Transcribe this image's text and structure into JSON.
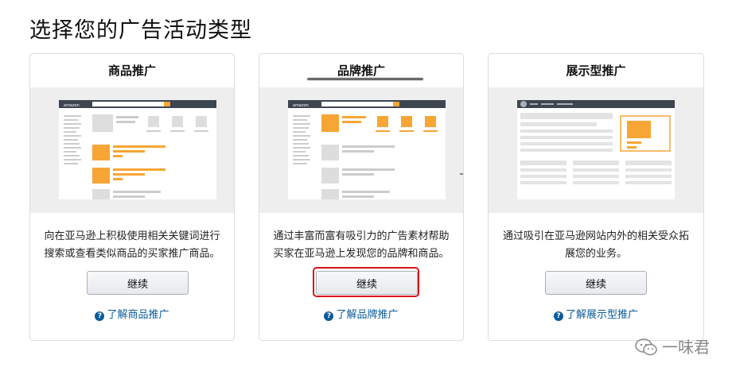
{
  "page": {
    "title": "选择您的广告活动类型"
  },
  "cards": [
    {
      "title": "商品推广",
      "description": "向在亚马逊上积极使用相关关键词进行搜索或查看类似商品的买家推广商品。",
      "button_label": "继续",
      "learn_more": "了解商品推广"
    },
    {
      "title": "品牌推广",
      "description": "通过丰富而富有吸引力的广告素材帮助买家在亚马逊上发现您的品牌和商品。",
      "button_label": "继续",
      "learn_more": "了解品牌推广"
    },
    {
      "title": "展示型推广",
      "description": "通过吸引在亚马逊网站内外的相关受众拓展您的业务。",
      "button_label": "继续",
      "learn_more": "了解展示型推广"
    }
  ],
  "logo_text": "amazon",
  "help_icon_glyph": "?",
  "watermark": {
    "text": "一味君",
    "icon": "wechat-icon"
  },
  "colors": {
    "accent_orange": "#f7a535",
    "link_blue": "#0a5c9b",
    "highlight_red": "#d9131b",
    "nav_dark": "#3d4550"
  }
}
